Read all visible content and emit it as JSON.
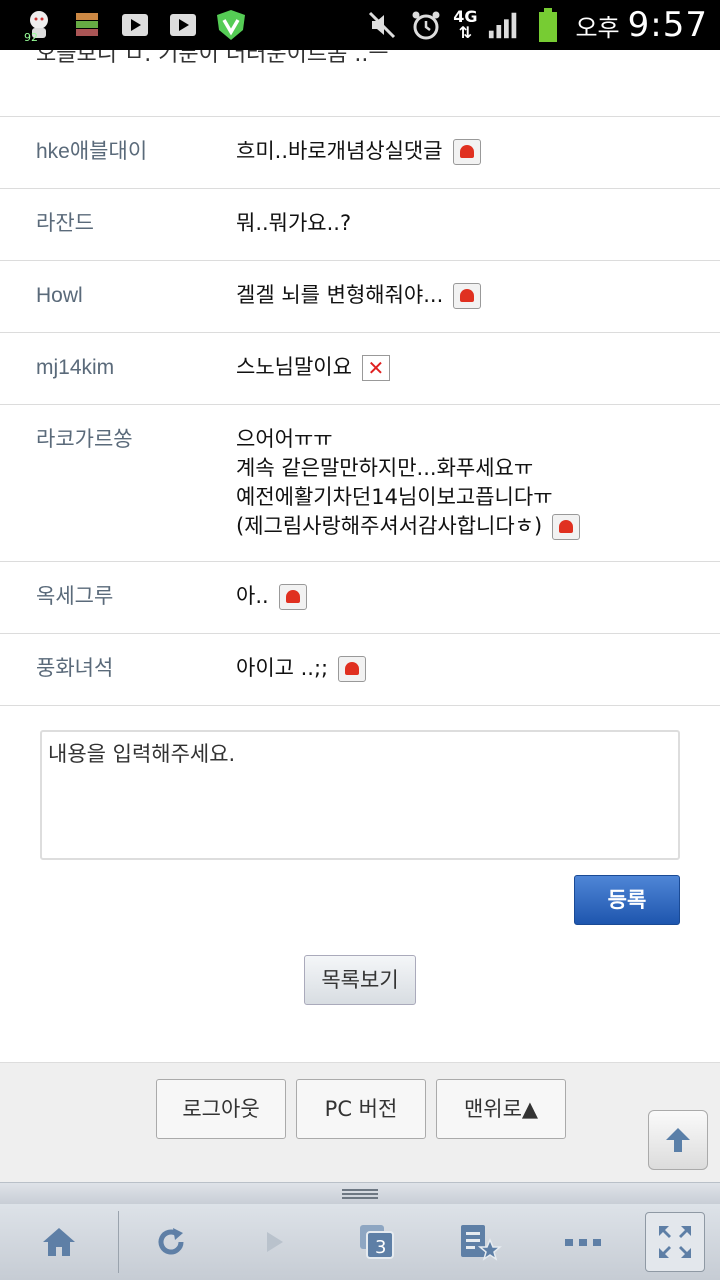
{
  "status_bar": {
    "notif_count": "92",
    "network": "4G",
    "ampm": "오후",
    "time": "9:57"
  },
  "page": {
    "cutoff_text": "오늘보니 ㅁ. 기분이 더러운이르몸 ..ㅡ"
  },
  "comments": [
    {
      "author": "hke애블대이",
      "lines": [
        "흐미..바로개념상실댓글"
      ],
      "badge": "siren"
    },
    {
      "author": "라잔드",
      "lines": [
        "뭐..뭐가요..?"
      ],
      "badge": ""
    },
    {
      "author": "Howl",
      "lines": [
        "겔겔 뇌를 변형해줘야..."
      ],
      "badge": "siren"
    },
    {
      "author": "mj14kim",
      "lines": [
        "스노님말이요"
      ],
      "badge": "x"
    },
    {
      "author": "라코가르쏭",
      "lines": [
        "으어어ㅠㅠ",
        "계속 같은말만하지만...화푸세요ㅠ",
        "예전에활기차던14님이보고픕니다ㅠ",
        "(제그림사랑해주셔서감사합니다ㅎ)"
      ],
      "badge": "siren"
    },
    {
      "author": "옥세그루",
      "lines": [
        "아.."
      ],
      "badge": "siren"
    },
    {
      "author": "풍화녀석",
      "lines": [
        "아이고 ..;;"
      ],
      "badge": "siren"
    }
  ],
  "form": {
    "placeholder": "내용을 입력해주세요.",
    "submit_label": "등록",
    "list_label": "목록보기"
  },
  "footer": {
    "logout_label": "로그아웃",
    "pc_label": "PC 버전",
    "top_label": "맨위로▲"
  },
  "browser_bar": {
    "tab_count": "3"
  },
  "colors": {
    "accent": "#2a64bd",
    "author": "#5a6a7a"
  }
}
